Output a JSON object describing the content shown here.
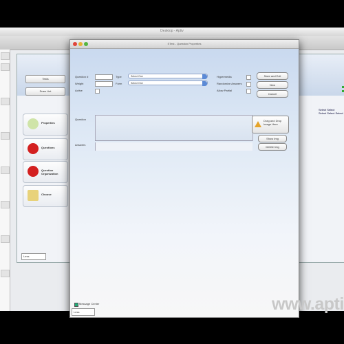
{
  "outer": {
    "title": "Desktop - Aptiv"
  },
  "mid": {
    "buttons": [
      "Tests",
      "Draw List"
    ],
    "nav": [
      {
        "label": "Properties",
        "color": "#cfe4a8",
        "icon": "properties-icon"
      },
      {
        "label": "Questions",
        "color": "#d32020",
        "icon": "question-icon"
      },
      {
        "label": "Question Organization",
        "color": "#d32020",
        "icon": "question-organization-icon"
      },
      {
        "label": "Choose",
        "color": "#e8d27a",
        "icon": "choose-icon"
      }
    ],
    "zoom": "Less",
    "side_text": [
      "Select Select",
      "Select Select Select"
    ]
  },
  "dialog": {
    "title": "STest - Question Properties",
    "labels": {
      "question": "Question #",
      "weight": "Weight",
      "active": "Active",
      "type": "Type",
      "form": "Form",
      "hypermedia": "Hypermedia",
      "randomize": "Randomize Answers",
      "allow_partial": "Allow Partial",
      "question_text": "Question",
      "answers": "Answers"
    },
    "type_value": "Select One",
    "form_value": "Select One",
    "buttons": {
      "save": "Save and Exit",
      "new": "New",
      "cancel": "Cancel",
      "add_image": "Drag and Drop Image Here",
      "show_img": "Show Img",
      "delete_img": "Delete Img"
    },
    "message_label": "Message Center",
    "zoom": "Less"
  },
  "watermark": "www.apti"
}
